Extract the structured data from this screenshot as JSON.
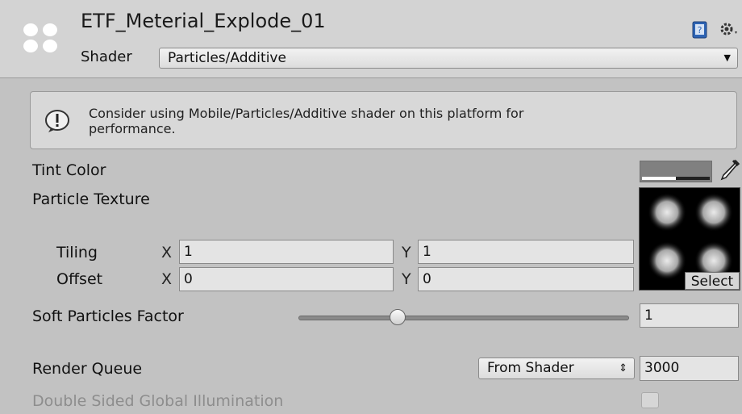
{
  "header": {
    "title": "ETF_Meterial_Explode_01",
    "shader_label": "Shader",
    "shader_value": "Particles/Additive",
    "help_icon": "help-book-icon",
    "settings_icon": "gear-icon"
  },
  "warning": {
    "icon": "exclamation-icon",
    "line1": "Consider using Mobile/Particles/Additive shader on this platform for",
    "line2": "performance."
  },
  "tint_color": {
    "label": "Tint Color",
    "color": "#808080",
    "alpha": 0.5,
    "picker_icon": "eyedropper-icon"
  },
  "particle_texture": {
    "label": "Particle Texture",
    "select_label": "Select",
    "tiling": {
      "label": "Tiling",
      "x_label": "X",
      "x": "1",
      "y_label": "Y",
      "y": "1"
    },
    "offset": {
      "label": "Offset",
      "x_label": "X",
      "x": "0",
      "y_label": "Y",
      "y": "0"
    }
  },
  "soft_particles": {
    "label": "Soft Particles Factor",
    "value": "1",
    "slider_fraction": 0.3
  },
  "render_queue": {
    "label": "Render Queue",
    "mode": "From Shader",
    "value": "3000"
  },
  "double_sided": {
    "label": "Double Sided Global Illumination",
    "checked": false
  }
}
